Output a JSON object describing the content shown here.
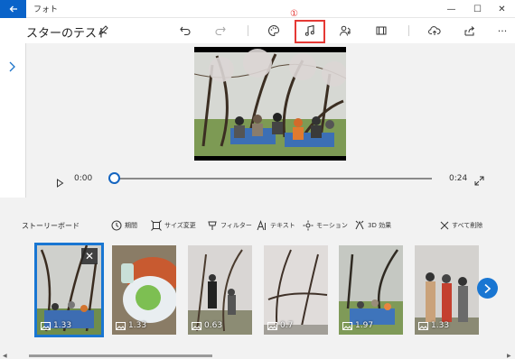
{
  "window": {
    "app_name": "フォト",
    "back_icon": "back-arrow-icon",
    "minimize_glyph": "—",
    "maximize_glyph": "☐",
    "close_glyph": "✕"
  },
  "toolbar": {
    "project_title": "スターのテスト",
    "callout_number": "①",
    "highlight_color": "#e53935",
    "icons": [
      "pencil-icon",
      "undo-icon",
      "redo-icon",
      "palette-icon",
      "music-note-icon",
      "narration-icon",
      "aspect-ratio-icon",
      "cloud-upload-icon",
      "share-icon",
      "more-icon"
    ],
    "more_label": "···"
  },
  "player": {
    "current_time": "0:00",
    "end_time": "0:24",
    "progress": 0.0
  },
  "storyboard": {
    "title": "ストーリーボード",
    "tools": [
      {
        "id": "duration",
        "label": "期間"
      },
      {
        "id": "resize",
        "label": "サイズ変更"
      },
      {
        "id": "filter",
        "label": "フィルター"
      },
      {
        "id": "text",
        "label": "テキスト"
      },
      {
        "id": "motion",
        "label": "モーション"
      },
      {
        "id": "effects3d",
        "label": "3D 効果"
      },
      {
        "id": "delete_all",
        "label": "すべて削除"
      }
    ],
    "clips": [
      {
        "duration": "1.33",
        "selected": true
      },
      {
        "duration": "1.33",
        "selected": false
      },
      {
        "duration": "0.63",
        "selected": false
      },
      {
        "duration": "0.7",
        "selected": false
      },
      {
        "duration": "1.97",
        "selected": false
      },
      {
        "duration": "1.33",
        "selected": false
      }
    ],
    "accent_color": "#1976d2"
  }
}
